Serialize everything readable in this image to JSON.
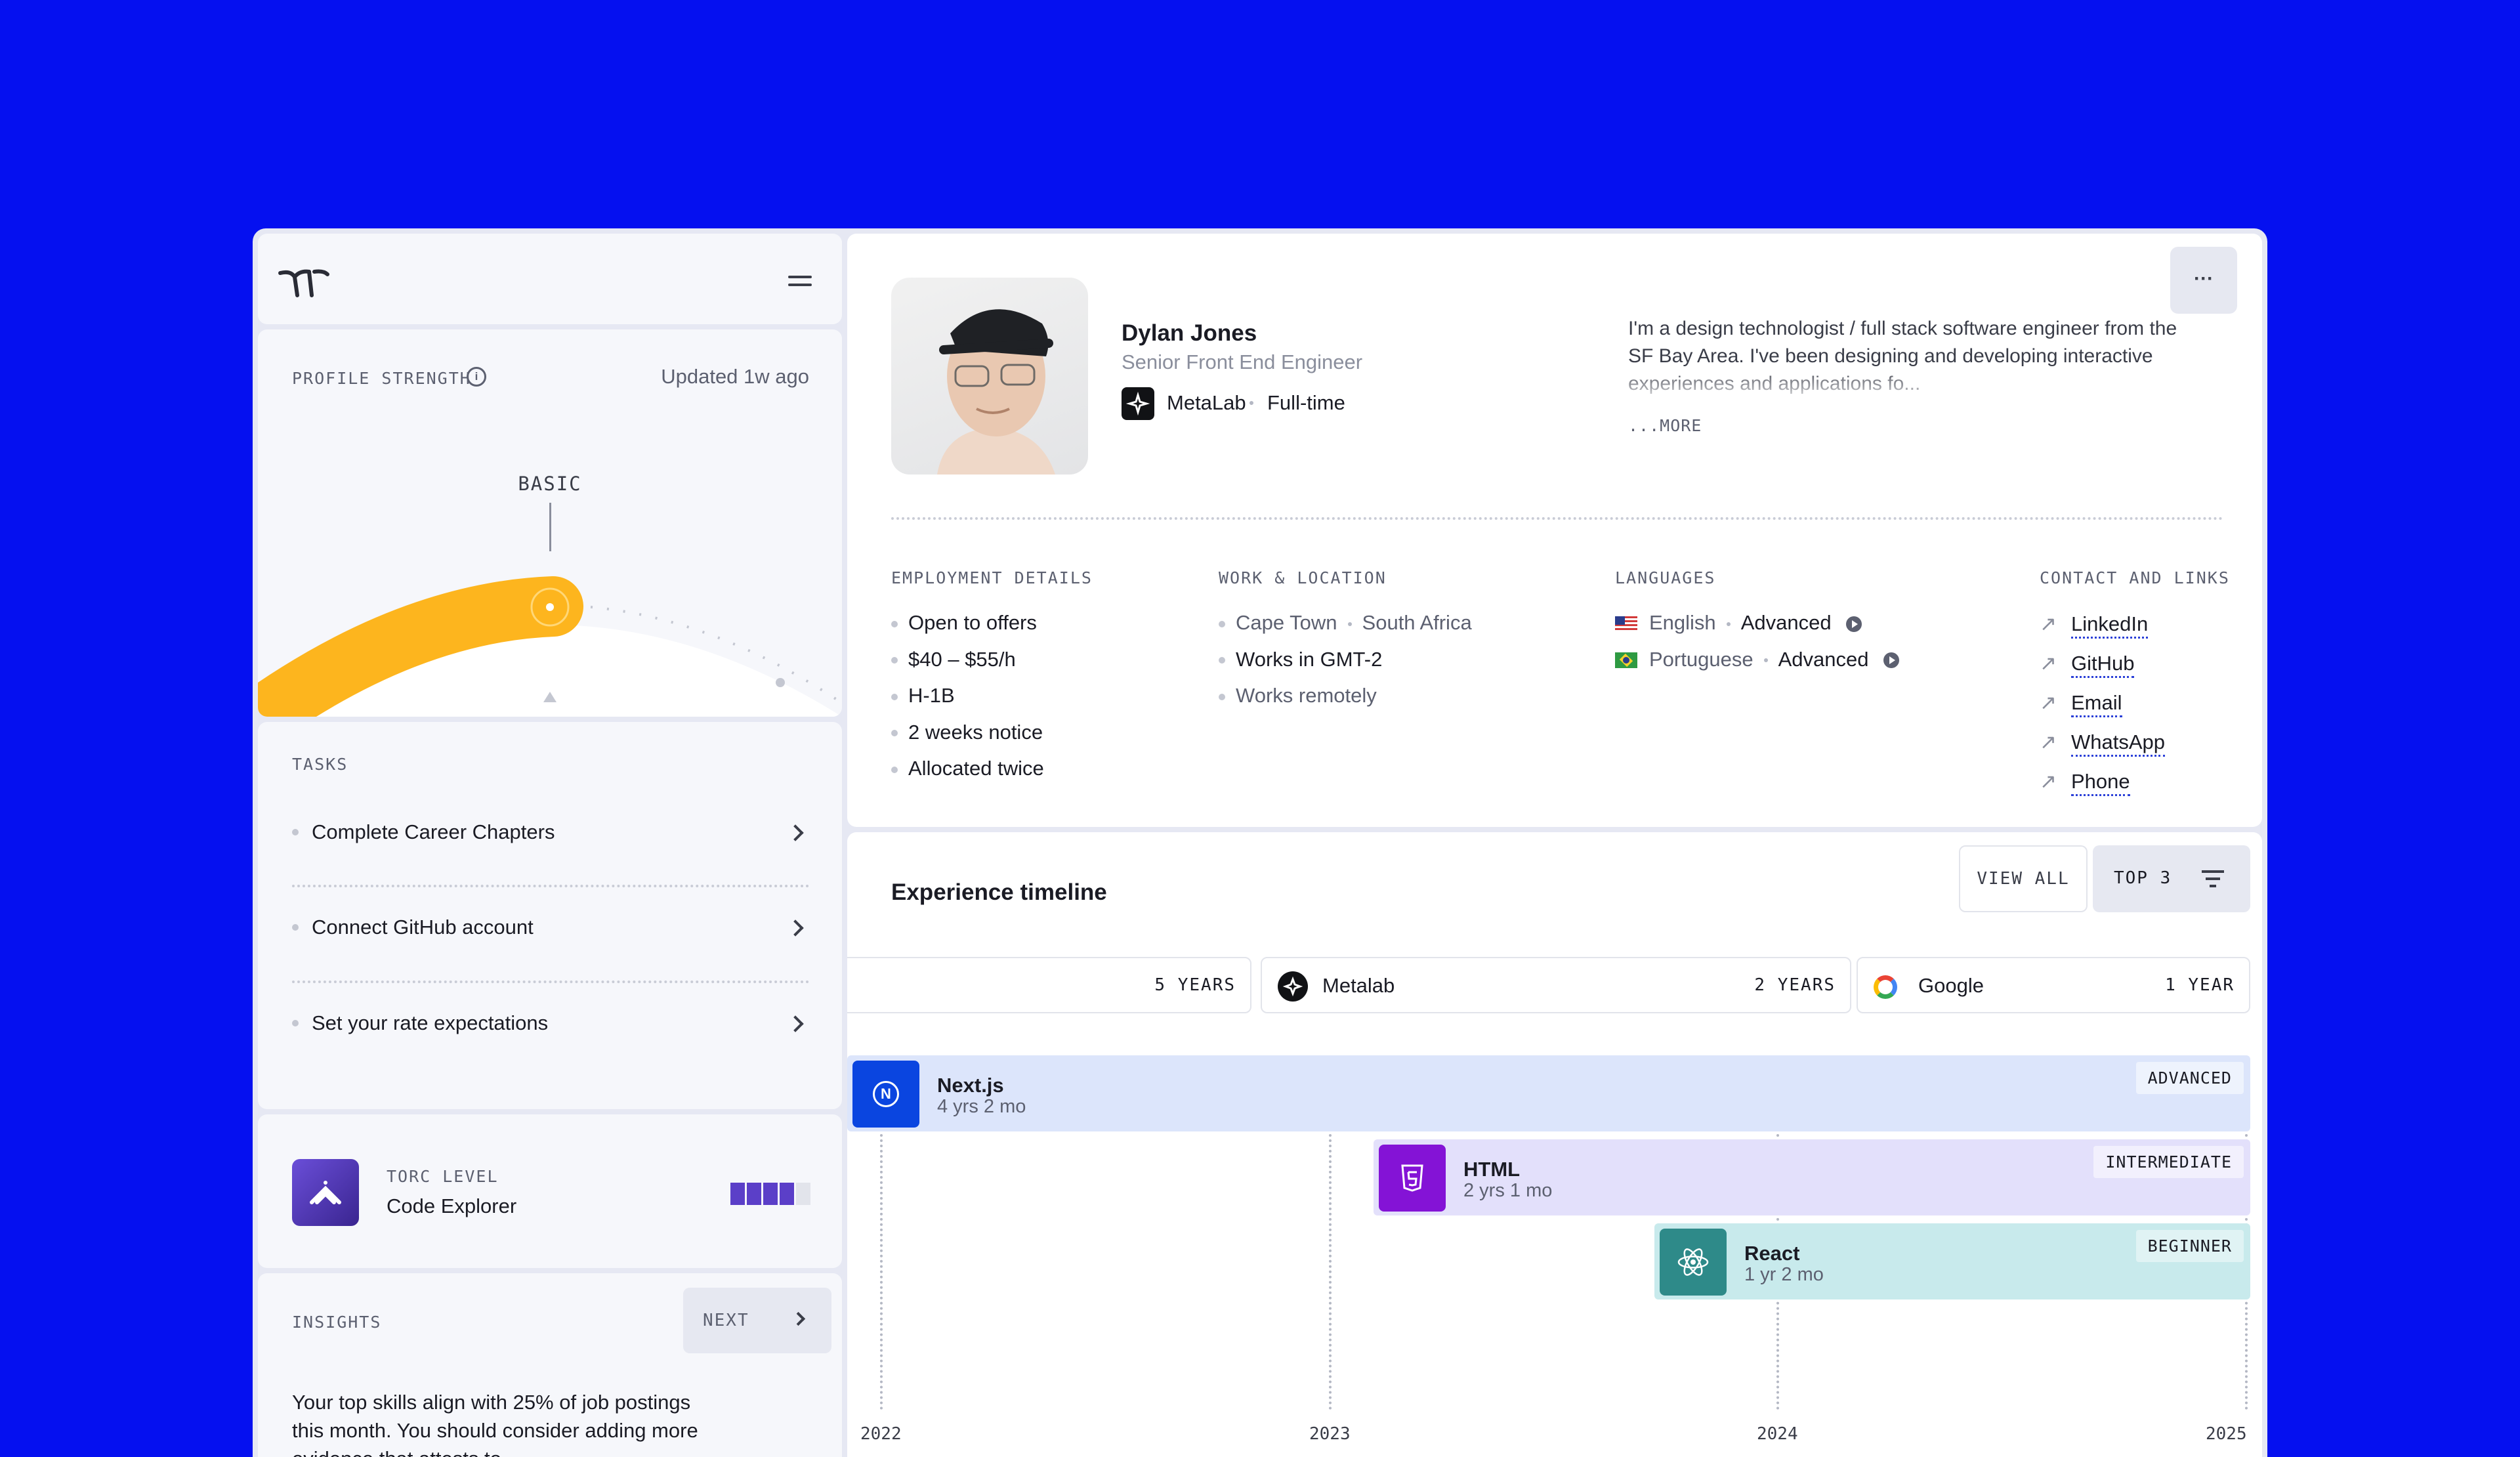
{
  "colors": {
    "background": "#0510F0",
    "accent": "#FDB51E",
    "torc": "#5B3FC8",
    "nextjs": "#0A45E0",
    "html": "#8413D6",
    "react": "#2E8A89"
  },
  "sidebar": {
    "logo_icon": "torc-logo-icon",
    "menu_icon": "hamburger-menu-icon",
    "profile_strength": {
      "label": "PROFILE STRENGTH",
      "updated": "Updated 1w ago",
      "level": "BASIC"
    },
    "tasks": {
      "label": "TASKS",
      "items": [
        {
          "label": "Complete Career Chapters"
        },
        {
          "label": "Connect GitHub account"
        },
        {
          "label": "Set your rate expectations"
        }
      ]
    },
    "torc_level": {
      "label": "TORC LEVEL",
      "value": "Code Explorer",
      "filled": 4,
      "total": 5
    },
    "insights": {
      "label": "INSIGHTS",
      "next": "NEXT",
      "text": "Your top skills align with 25% of job postings this month. You should consider adding more evidence that attests to"
    }
  },
  "profile": {
    "name": "Dylan Jones",
    "title": "Senior Front End Engineer",
    "company": "MetaLab",
    "employment_type": "Full-time",
    "bio": "I'm a design technologist / full stack software engineer from the SF Bay Area. I've been designing and developing interactive experiences and applications fo...",
    "more": "...MORE",
    "more_button": "···"
  },
  "details": {
    "employment": {
      "label": "EMPLOYMENT DETAILS",
      "items": [
        "Open to offers",
        "$40 – $55/h",
        "H-1B",
        "2 weeks notice",
        "Allocated twice"
      ]
    },
    "work_location": {
      "label": "WORK & LOCATION",
      "city": "Cape Town",
      "country": "South Africa",
      "items": [
        "Works in GMT-2",
        "Works remotely"
      ]
    },
    "languages": {
      "label": "LANGUAGES",
      "items": [
        {
          "name": "English",
          "level": "Advanced"
        },
        {
          "name": "Portuguese",
          "level": "Advanced"
        }
      ]
    },
    "contact": {
      "label": "CONTACT AND LINKS",
      "items": [
        "LinkedIn",
        "GitHub",
        "Email",
        "WhatsApp",
        "Phone"
      ]
    }
  },
  "timeline": {
    "title": "Experience timeline",
    "view_all": "VIEW ALL",
    "top": "TOP 3",
    "companies": [
      {
        "name": "",
        "duration": "5 YEARS"
      },
      {
        "name": "Metalab",
        "duration": "2 YEARS"
      },
      {
        "name": "Google",
        "duration": "1 YEAR"
      }
    ],
    "skills": [
      {
        "name": "Next.js",
        "duration": "4 yrs 2 mo",
        "level": "ADVANCED"
      },
      {
        "name": "HTML",
        "duration": "2 yrs 1 mo",
        "level": "INTERMEDIATE"
      },
      {
        "name": "React",
        "duration": "1 yr 2 mo",
        "level": "BEGINNER"
      }
    ],
    "years": [
      "2022",
      "2023",
      "2024",
      "2025"
    ]
  }
}
